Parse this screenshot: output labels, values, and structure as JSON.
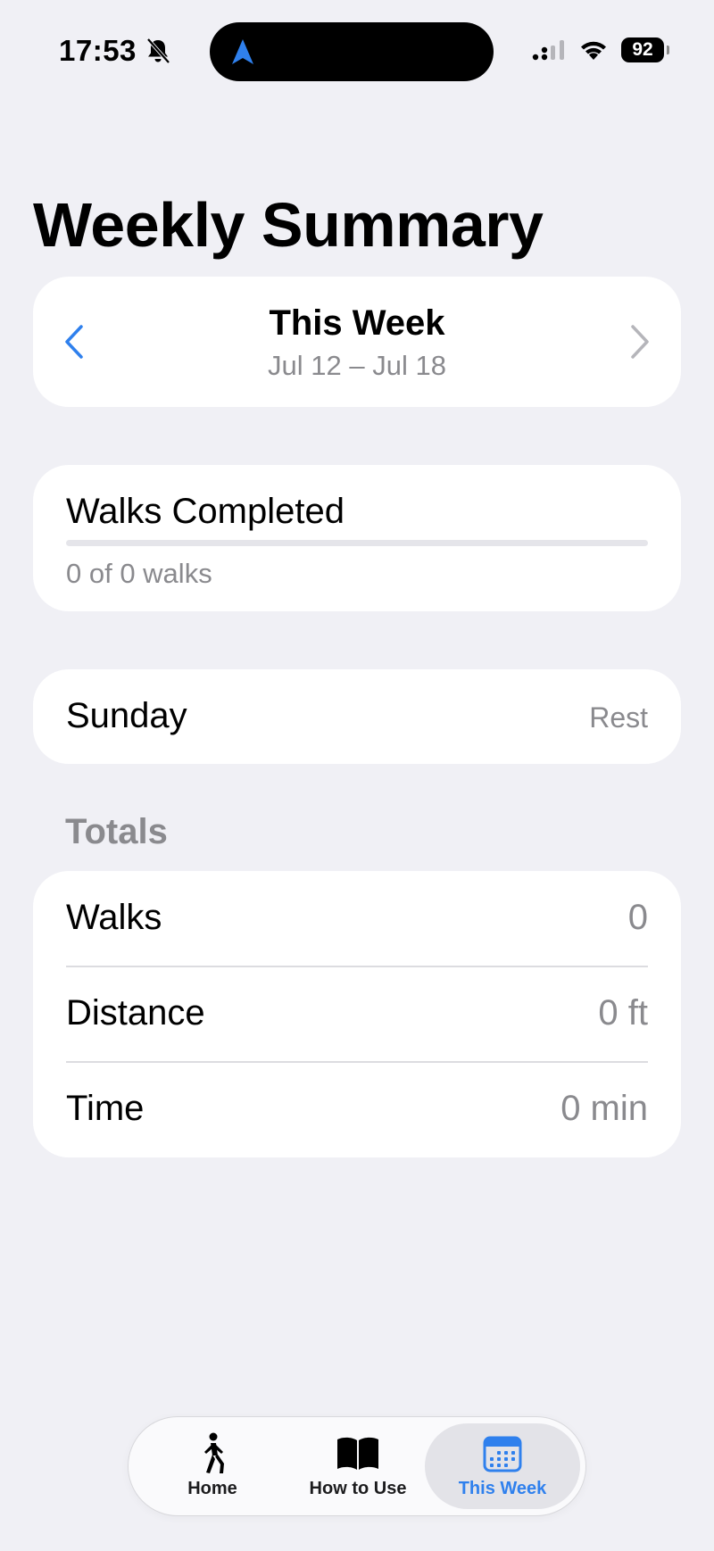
{
  "status_bar": {
    "time": "17:53",
    "battery": "92",
    "icons": [
      "bell-slash-icon",
      "location-arrow-icon",
      "signal-icon",
      "wifi-icon",
      "battery-icon"
    ]
  },
  "page": {
    "title": "Weekly Summary"
  },
  "week_selector": {
    "title": "This Week",
    "range": "Jul 12 – Jul 18",
    "prev_icon": "chevron-left-icon",
    "next_icon": "chevron-right-icon"
  },
  "walks_completed": {
    "label": "Walks Completed",
    "progress_fraction": 0,
    "subtitle": "0 of 0 walks"
  },
  "day": {
    "label": "Sunday",
    "value": "Rest"
  },
  "totals": {
    "header": "Totals",
    "rows": [
      {
        "label": "Walks",
        "value": "0"
      },
      {
        "label": "Distance",
        "value": "0 ft"
      },
      {
        "label": "Time",
        "value": "0 min"
      }
    ]
  },
  "tab_bar": {
    "tabs": [
      {
        "label": "Home",
        "icon": "walking-figure-icon",
        "active": false
      },
      {
        "label": "How to Use",
        "icon": "book-icon",
        "active": false
      },
      {
        "label": "This Week",
        "icon": "calendar-icon",
        "active": true
      }
    ]
  },
  "colors": {
    "background": "#f0f0f5",
    "accent": "#2f80ed",
    "secondary_text": "#8a8a8e",
    "card": "#ffffff"
  }
}
